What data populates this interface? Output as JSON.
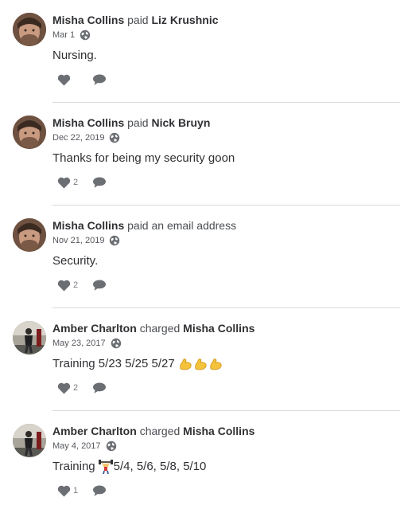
{
  "stories": [
    {
      "actor": "Misha Collins",
      "verb": "paid",
      "target": "Liz Krushnic",
      "date": "Mar 1",
      "note": "Nursing.",
      "note_emojis": [],
      "emoji_position": "none",
      "likes": "",
      "avatar": "misha"
    },
    {
      "actor": "Misha Collins",
      "verb": "paid",
      "target": "Nick Bruyn",
      "date": "Dec 22, 2019",
      "note": "Thanks for being my security goon",
      "note_emojis": [],
      "emoji_position": "none",
      "likes": "2",
      "avatar": "misha"
    },
    {
      "actor": "Misha Collins",
      "verb": "paid an email address",
      "target": "",
      "date": "Nov 21, 2019",
      "note": "Security.",
      "note_emojis": [],
      "emoji_position": "none",
      "likes": "2",
      "avatar": "misha"
    },
    {
      "actor": "Amber Charlton",
      "verb": "charged",
      "target": "Misha Collins",
      "date": "May 23, 2017",
      "note": "Training 5/23 5/25 5/27",
      "note_emojis": [
        "flexed-biceps-icon",
        "flexed-biceps-icon",
        "flexed-biceps-icon"
      ],
      "emoji_position": "after",
      "likes": "2",
      "avatar": "amber"
    },
    {
      "actor": "Amber Charlton",
      "verb": "charged",
      "target": "Misha Collins",
      "date": "May 4, 2017",
      "note_prefix": "Training",
      "note": "5/4, 5/6, 5/8, 5/10",
      "note_emojis": [
        "weight-lifter-icon"
      ],
      "emoji_position": "middle",
      "likes": "1",
      "avatar": "amber"
    }
  ],
  "colors": {
    "text": "#2f3033",
    "muted": "#55585e",
    "icon": "#6b6e73",
    "divider": "#d9dadc"
  }
}
